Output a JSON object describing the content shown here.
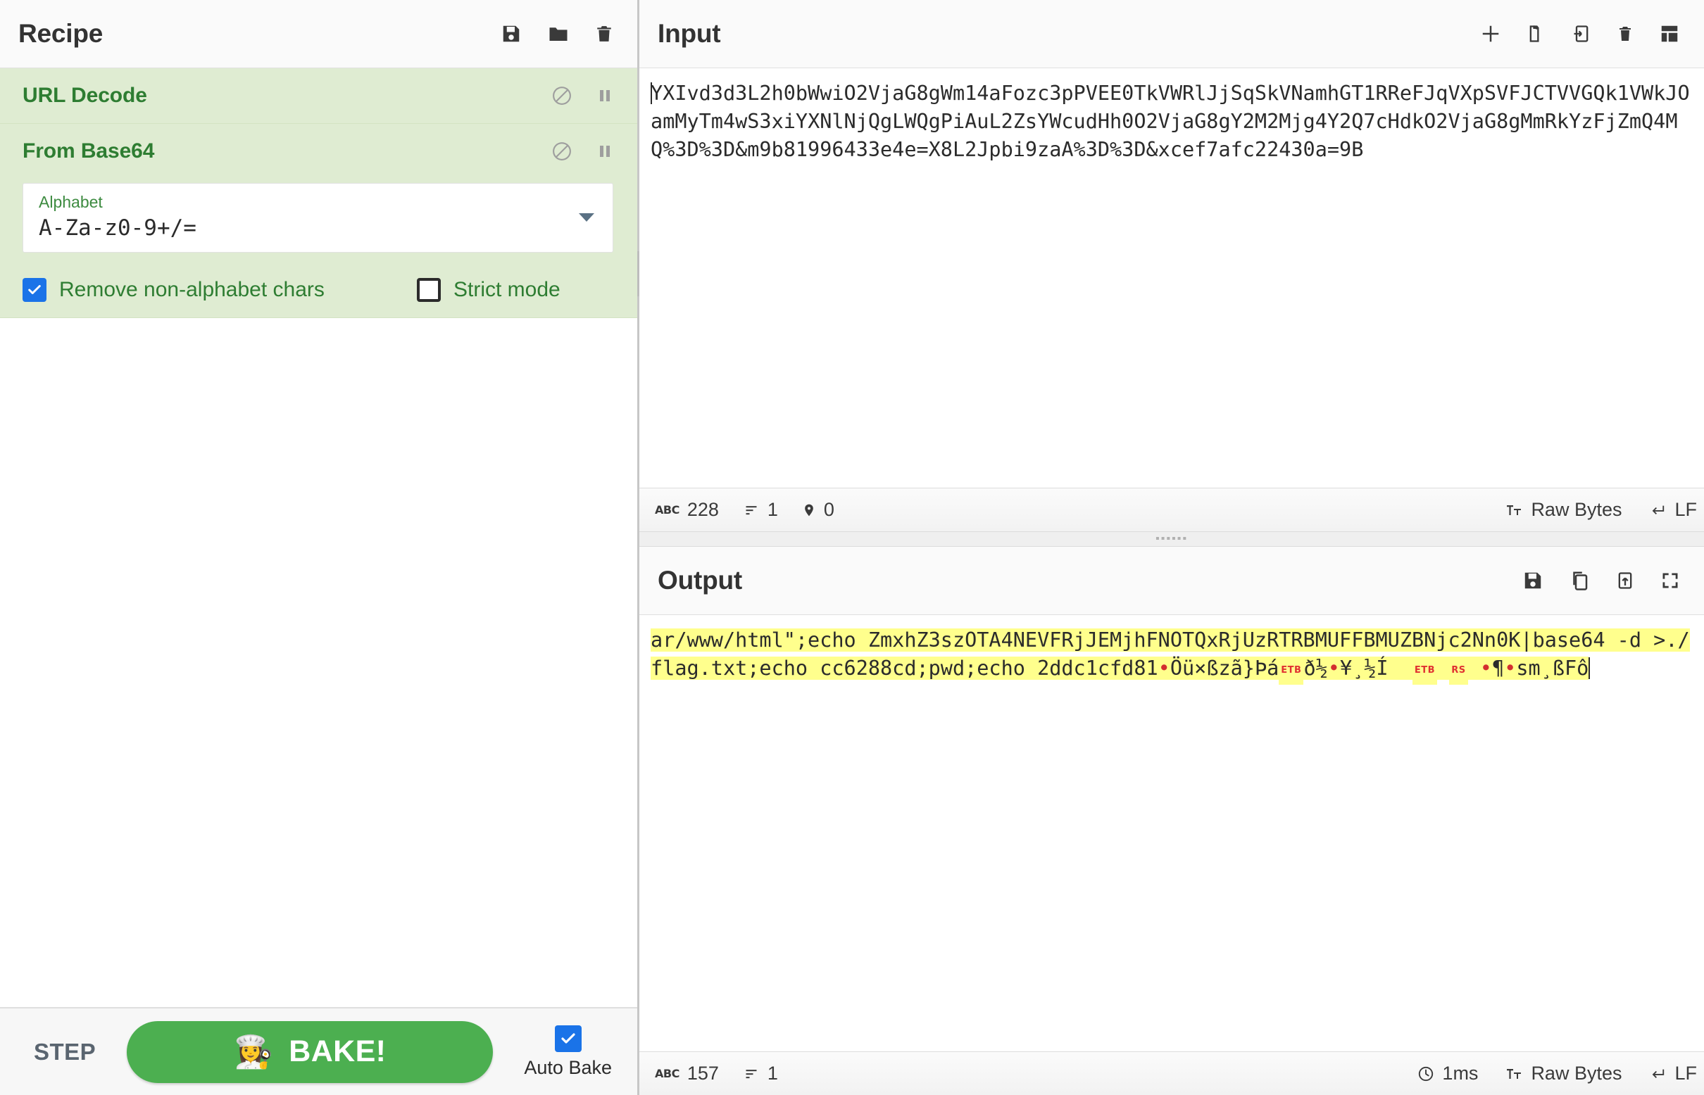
{
  "recipe": {
    "title": "Recipe",
    "header_icons": [
      {
        "name": "save-recipe-icon",
        "label": "Save recipe"
      },
      {
        "name": "load-recipe-icon",
        "label": "Load recipe"
      },
      {
        "name": "clear-recipe-icon",
        "label": "Clear recipe"
      }
    ],
    "operations": [
      {
        "name": "URL Decode",
        "disable_label": "Disable operation",
        "breakpoint_label": "Set breakpoint"
      },
      {
        "name": "From Base64",
        "disable_label": "Disable operation",
        "breakpoint_label": "Set breakpoint",
        "args": {
          "alphabet": {
            "label": "Alphabet",
            "value": "A-Za-z0-9+/="
          },
          "remove_non_alphabet": {
            "label": "Remove non-alphabet chars",
            "checked": true
          },
          "strict_mode": {
            "label": "Strict mode",
            "checked": false
          }
        }
      }
    ],
    "controls": {
      "step_label": "STEP",
      "bake_label": "BAKE!",
      "bake_emoji": "👩‍🍳",
      "auto_bake_label": "Auto Bake",
      "auto_bake_checked": true,
      "bake_color": "#4caf50"
    }
  },
  "input": {
    "title": "Input",
    "header_icons": [
      {
        "name": "add-input-tab-icon",
        "label": "Add a new input"
      },
      {
        "name": "open-folder-icon",
        "label": "Open folder as input"
      },
      {
        "name": "open-file-icon",
        "label": "Open file as input"
      },
      {
        "name": "clear-io-icon",
        "label": "Clear input and output"
      },
      {
        "name": "reset-pane-layout-icon",
        "label": "Reset pane layout"
      }
    ],
    "value_line1": "YXIvd3d3L2h0bWwiO2VjaG8gWm14aFozc3pPVEE0TkVWRlJjSqSkVNamhGT1RReFJqVXpSVFJCTVVGQk1VWkJOamMy",
    "value_line2": "Tm4wS3xiYXNlNjQgLWQgPiAuL2ZsYWcudHh0O2VjaG8gY2M2Mjg4Y2Q7cHdkO2VjaG8gMmRkYzFjZmQ4MQ%3D%3D",
    "value_line3": "&m9b81996433e4e=X8L2Jpbi9zaA%3D%3D&xcef7afc22430a=9B",
    "status": {
      "length_icon": "character-count-icon",
      "length": "228",
      "lines_icon": "line-count-icon",
      "lines": "1",
      "position_icon": "cursor-position-icon",
      "position": "0",
      "encoding_icon": "character-encoding-icon",
      "encoding": "Raw Bytes",
      "line_ending_icon": "line-ending-icon",
      "line_ending": "LF"
    }
  },
  "output": {
    "title": "Output",
    "header_icons": [
      {
        "name": "save-output-icon",
        "label": "Save output to file"
      },
      {
        "name": "copy-output-icon",
        "label": "Copy raw output to clipboard"
      },
      {
        "name": "replace-input-icon",
        "label": "Replace input with output"
      },
      {
        "name": "maximise-output-icon",
        "label": "Maximise output pane"
      }
    ],
    "highlight_color": "#ffff8d",
    "line1": "ar/www/html\";echo ZmxhZ3szOTA4NEVFRjJEMjhFNOTQxRjUzRTRBMUFFBMUZBNjc2Nn0K|base64 -d >",
    "line2_a": "./flag.txt;echo cc6288cd;pwd;echo 2ddc1cfd81",
    "line2_b": "Öü×ßzã}Þá",
    "line2_ctrl1": "ETB",
    "line2_c": "ð½",
    "line2_d": "¥¸½Í",
    "line2_ctrl2": "ETB",
    "line2_ctrl3": "RS",
    "line2_e": "¶",
    "line2_f": "sm¸ßFô",
    "status": {
      "length_icon": "character-count-icon",
      "length": "157",
      "lines_icon": "line-count-icon",
      "lines": "1",
      "time_icon": "bake-time-icon",
      "time": "1ms",
      "encoding_icon": "character-encoding-icon",
      "encoding": "Raw Bytes",
      "line_ending_icon": "line-ending-icon",
      "line_ending": "LF"
    }
  }
}
